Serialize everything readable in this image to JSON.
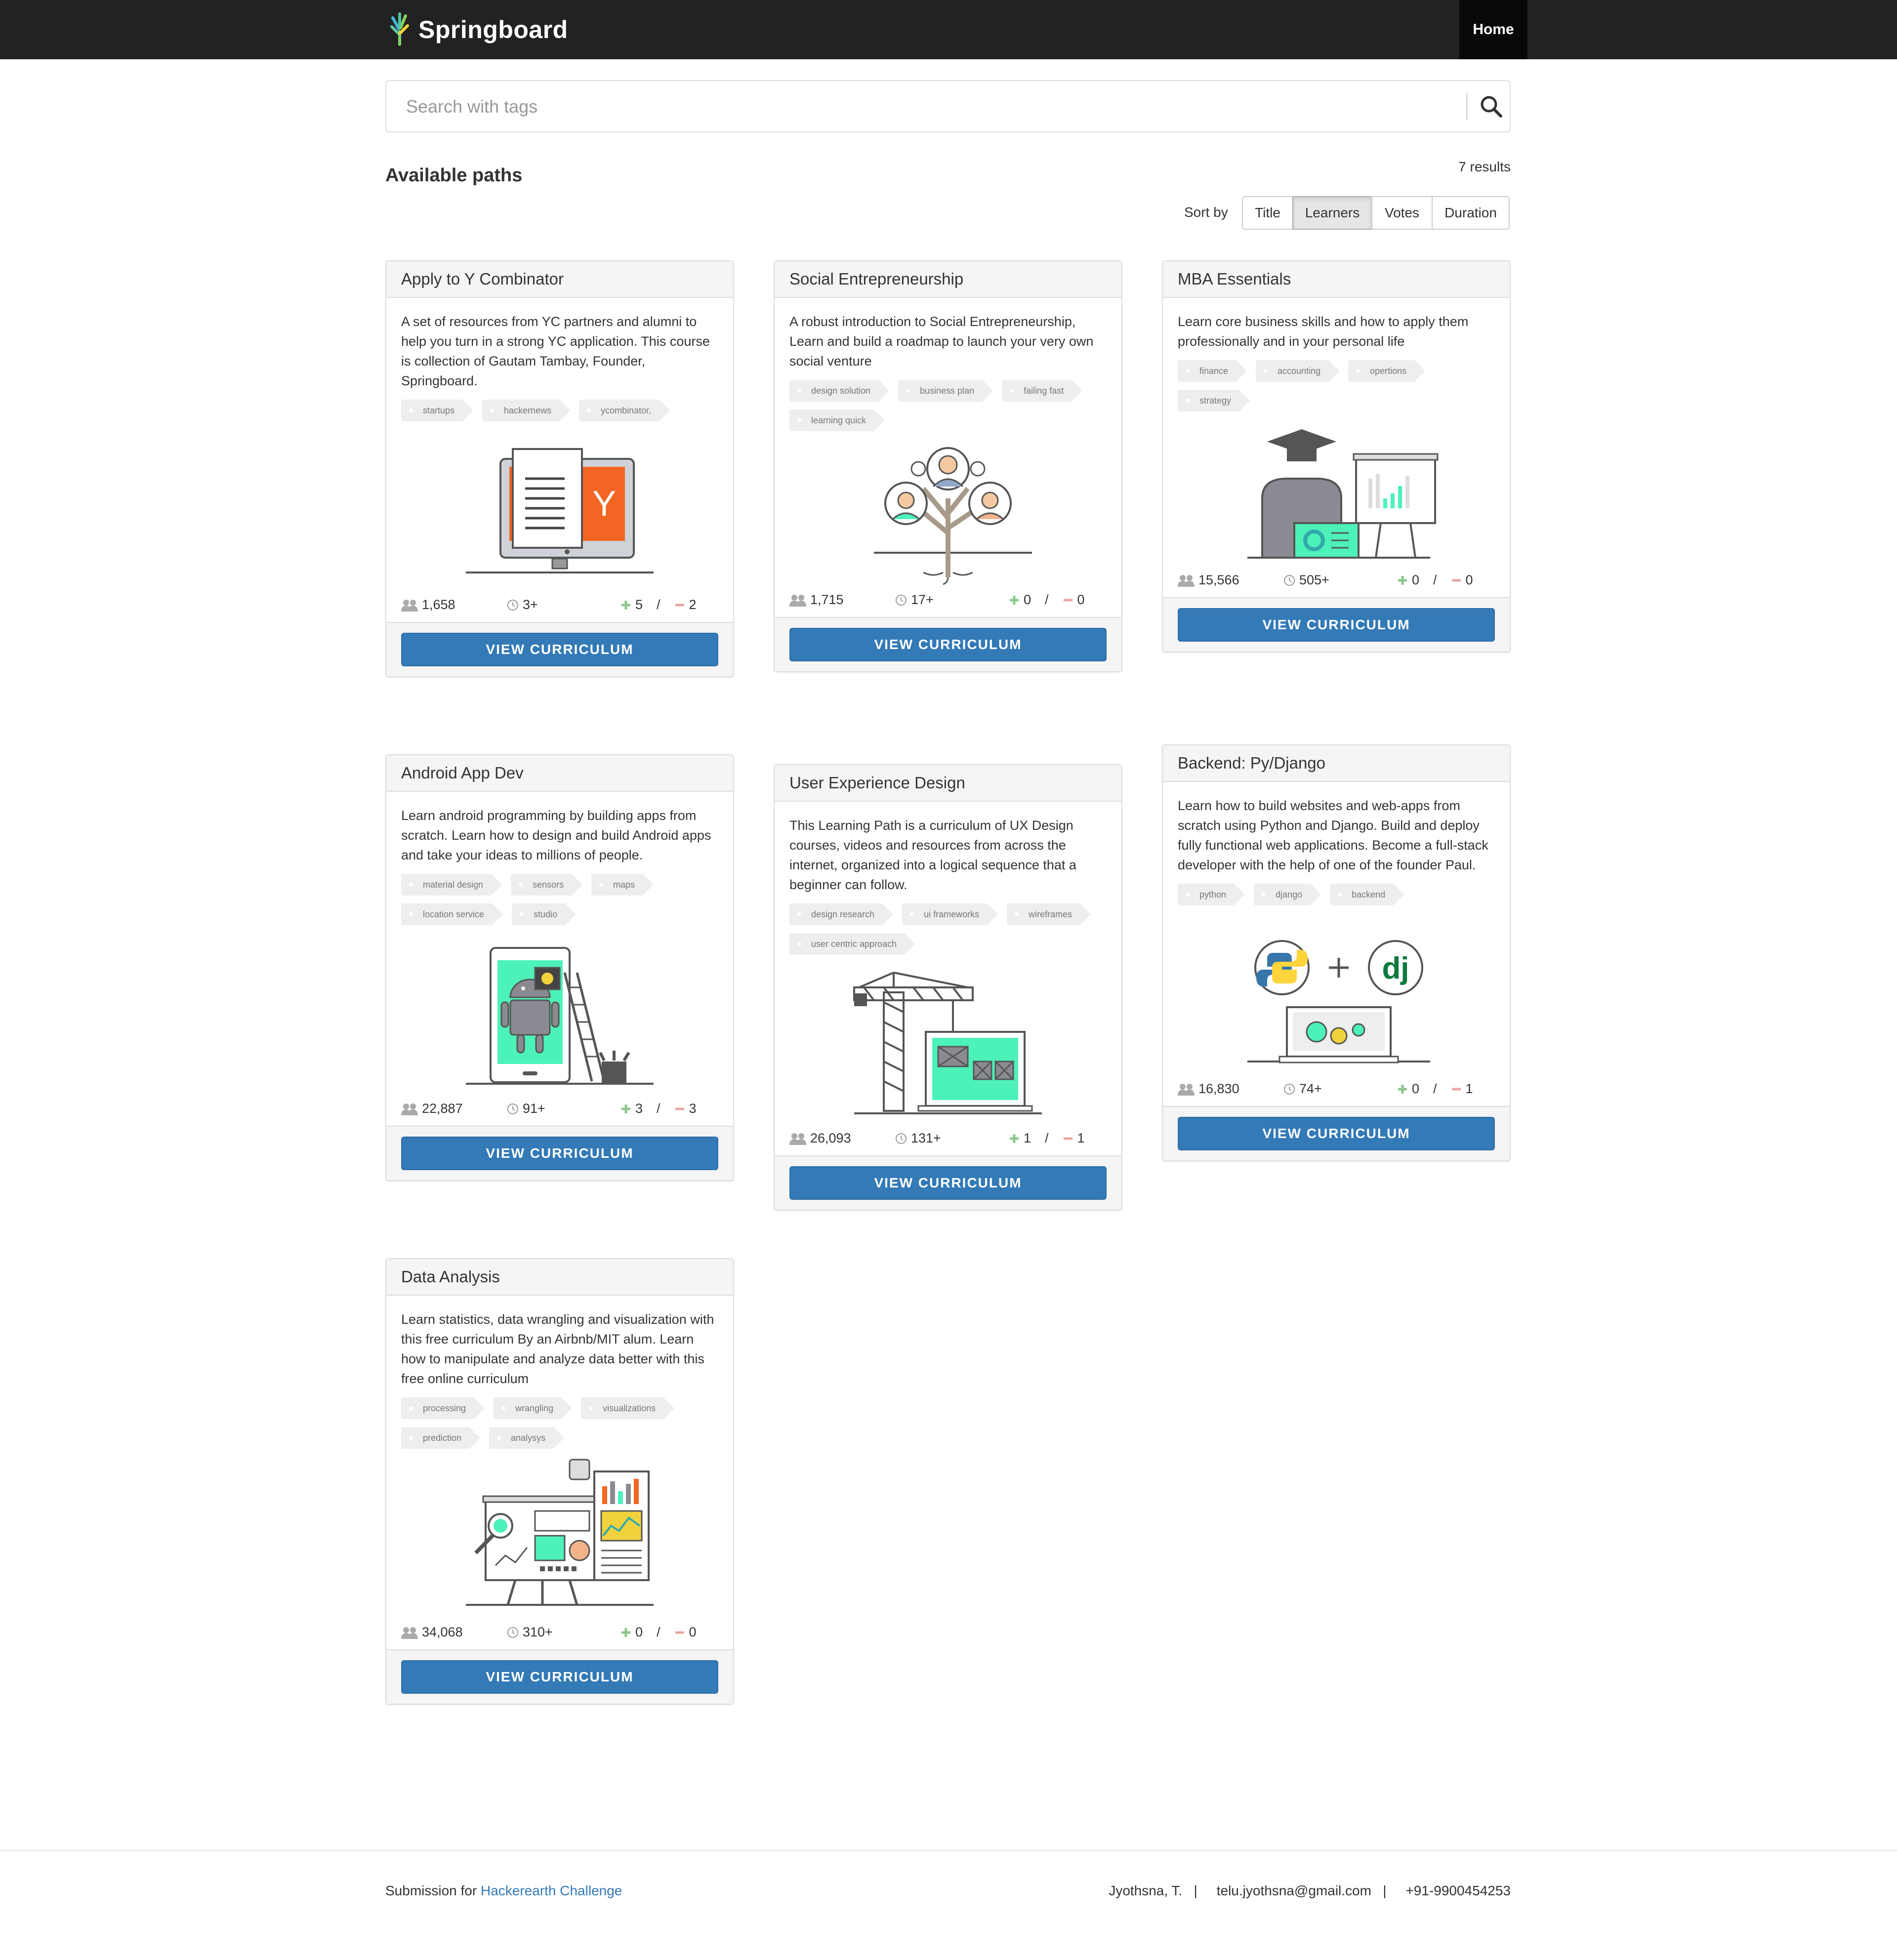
{
  "header": {
    "brand": "Springboard",
    "nav_home": "Home"
  },
  "search": {
    "placeholder": "Search with tags"
  },
  "paths_title": "Available paths",
  "results_count": "7 results",
  "sort": {
    "label": "Sort by",
    "options": [
      "Title",
      "Learners",
      "Votes",
      "Duration"
    ],
    "active": "Learners"
  },
  "cards": [
    {
      "title": "Apply to Y Combinator",
      "description": "A set of resources from YC partners and alumni to help you turn in a strong YC application. This course is collection of Gautam Tambay, Founder, Springboard.",
      "tags": [
        "startups",
        "hackernews",
        "ycombinator,"
      ],
      "learners": "1,658",
      "duration": "3+",
      "upvotes": "5",
      "downvotes": "2",
      "button": "VIEW CURRICULUM"
    },
    {
      "title": "Social Entrepreneurship",
      "description": "A robust introduction to Social Entrepreneurship, Learn and build a roadmap to launch your very own social venture",
      "tags": [
        "design solution",
        "business plan",
        "failing fast",
        "learning quick"
      ],
      "learners": "1,715",
      "duration": "17+",
      "upvotes": "0",
      "downvotes": "0",
      "button": "VIEW CURRICULUM"
    },
    {
      "title": "MBA Essentials",
      "description": "Learn core business skills and how to apply them professionally and in your personal life",
      "tags": [
        "finance",
        "accounting",
        "opertions",
        "strategy"
      ],
      "learners": "15,566",
      "duration": "505+",
      "upvotes": "0",
      "downvotes": "0",
      "button": "VIEW CURRICULUM"
    },
    {
      "title": "Android App Dev",
      "description": "Learn android programming by building apps from scratch. Learn how to design and build Android apps and take your ideas to millions of people.",
      "tags": [
        "material design",
        "sensors",
        "maps",
        "location service",
        "studio"
      ],
      "learners": "22,887",
      "duration": "91+",
      "upvotes": "3",
      "downvotes": "3",
      "button": "VIEW CURRICULUM"
    },
    {
      "title": "User Experience Design",
      "description": "This Learning Path is a curriculum of UX Design courses, videos and resources from across the internet, organized into a logical sequence that a beginner can follow.",
      "tags": [
        "design research",
        "ui frameworks",
        "wireframes",
        "user centric approach"
      ],
      "learners": "26,093",
      "duration": "131+",
      "upvotes": "1",
      "downvotes": "1",
      "button": "VIEW CURRICULUM"
    },
    {
      "title": "Backend: Py/Django",
      "description": "Learn how to build websites and web-apps from scratch using Python and Django. Build and deploy fully functional web applications. Become a full-stack developer with the help of one of the founder Paul.",
      "tags": [
        "python",
        "django",
        "backend"
      ],
      "learners": "16,830",
      "duration": "74+",
      "upvotes": "0",
      "downvotes": "1",
      "button": "VIEW CURRICULUM"
    },
    {
      "title": "Data Analysis",
      "description": "Learn statistics, data wrangling and visualization with this free curriculum By an Airbnb/MIT alum. Learn how to manipulate and analyze data better with this free online curriculum",
      "tags": [
        "processing",
        "wrangling",
        "visualizations",
        "prediction",
        "analysys"
      ],
      "learners": "34,068",
      "duration": "310+",
      "upvotes": "0",
      "downvotes": "0",
      "button": "VIEW CURRICULUM"
    }
  ],
  "footer": {
    "submission_prefix": "Submission for",
    "submission_link": "Hackerearth Challenge",
    "contact": "Jyothsna, T.   |     telu.jyothsna@gmail.com   |     +91-9900454253"
  },
  "colors": {
    "navbar": "#222222",
    "primary_button": "#337ab7",
    "upvote": "#5cb85c",
    "downvote": "#d9534f",
    "accent_illustration": "#4cf2b8"
  }
}
